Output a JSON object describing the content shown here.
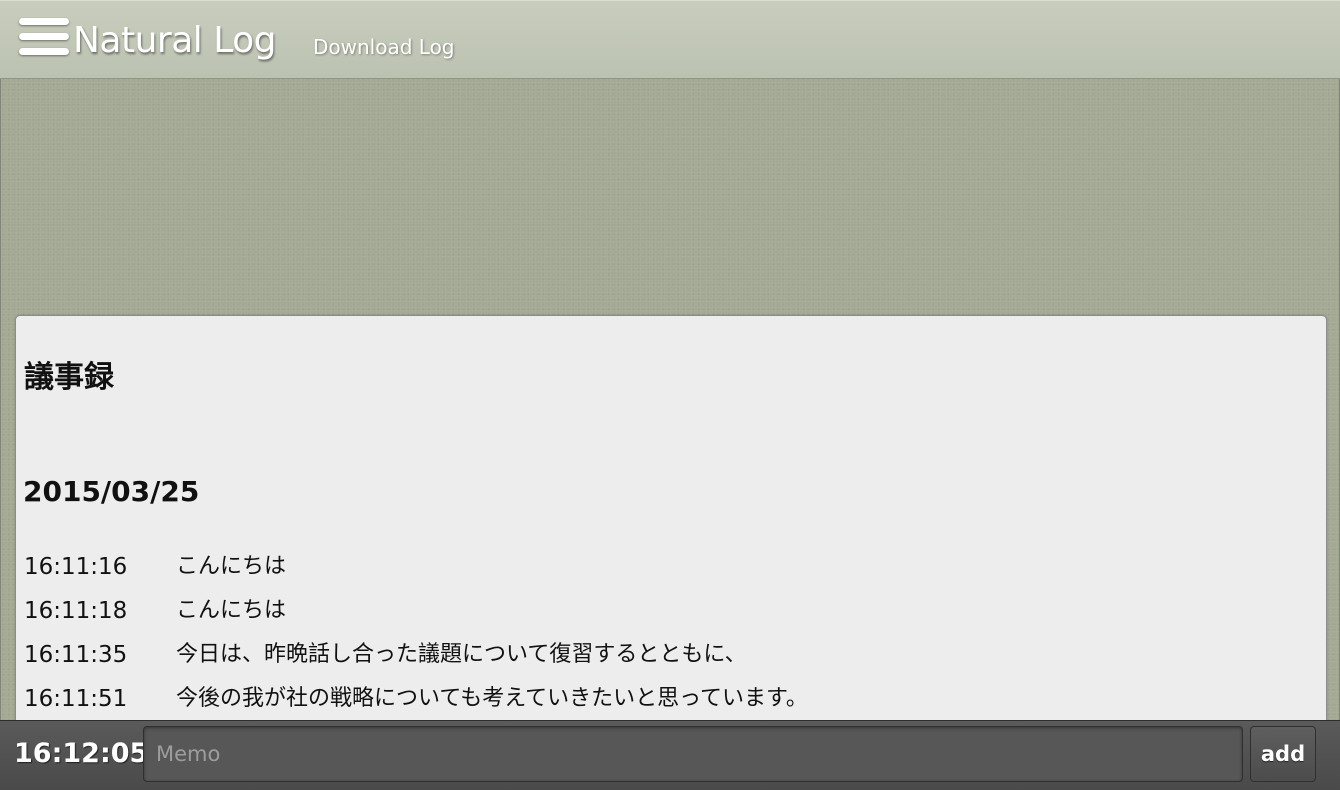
{
  "header": {
    "menu_icon": "hamburger-menu-icon",
    "title": "Natural Log",
    "download_label": "Download Log"
  },
  "document": {
    "title": "議事録",
    "date": "2015/03/25",
    "entries": [
      {
        "time": "16:11:16",
        "text": "こんにちは"
      },
      {
        "time": "16:11:18",
        "text": "こんにちは"
      },
      {
        "time": "16:11:35",
        "text": "今日は、昨晩話し合った議題について復習するとともに、"
      },
      {
        "time": "16:11:51",
        "text": "今後の我が社の戦略についても考えていきたいと思っています。"
      }
    ]
  },
  "input_bar": {
    "clock": "16:12:05",
    "memo_placeholder": "Memo",
    "memo_value": "",
    "add_label": "add"
  },
  "colors": {
    "background": "#a3aa94",
    "header": "#c3c8b7",
    "panel": "#ededed",
    "input_bar": "#525252",
    "text": "#111111"
  }
}
